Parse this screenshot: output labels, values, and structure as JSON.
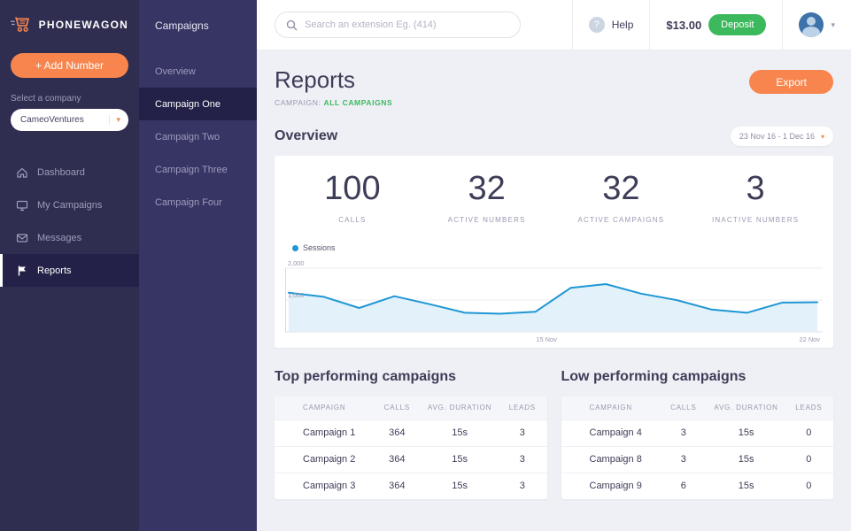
{
  "theme": {
    "accent": "#f8854e",
    "green": "#3cb95d",
    "chart_blue": "#1f97d4",
    "sidebar_bg": "#2f2e50",
    "subnav_bg": "#373564"
  },
  "brand": {
    "name": "PHONEWAGON"
  },
  "sidebar": {
    "add_number_label": "+ Add Number",
    "select_company_label": "Select a company",
    "company_selected": "CameoVentures",
    "items": [
      {
        "label": "Dashboard",
        "icon": "home"
      },
      {
        "label": "My Campaigns",
        "icon": "monitor"
      },
      {
        "label": "Messages",
        "icon": "envelope"
      },
      {
        "label": "Reports",
        "icon": "flag",
        "active": true
      }
    ]
  },
  "campaigns_panel": {
    "title": "Campaigns",
    "items": [
      "Overview",
      "Campaign One",
      "Campaign Two",
      "Campaign Three",
      "Campaign Four"
    ],
    "active_item": "Campaign One"
  },
  "topbar": {
    "search_placeholder": "Search an extension Eg. (414)",
    "help_label": "Help",
    "balance": "$13.00",
    "deposit_label": "Deposit"
  },
  "report": {
    "title": "Reports",
    "campaign_label": "CAMPAIGN:",
    "campaign_value": "ALL CAMPAIGNS",
    "export_label": "Export",
    "overview_title": "Overview",
    "date_range": "23 Nov 16  -  1 Dec 16",
    "stats": [
      {
        "value": "100",
        "label": "CALLS"
      },
      {
        "value": "32",
        "label": "ACTIVE NUMBERS"
      },
      {
        "value": "32",
        "label": "ACTIVE CAMPAIGNS"
      },
      {
        "value": "3",
        "label": "INACTIVE NUMBERS"
      }
    ]
  },
  "chart_data": {
    "type": "line",
    "title": "Sessions",
    "legend": [
      "Sessions"
    ],
    "color": "#1f97d4",
    "series": [
      {
        "name": "Sessions",
        "values": [
          1230,
          1100,
          750,
          1120,
          870,
          600,
          570,
          630,
          1380,
          1500,
          1200,
          1000,
          700,
          600,
          920,
          930
        ]
      }
    ],
    "ylim": [
      0,
      2200
    ],
    "ytick_labels": [
      "2,000",
      "1,000"
    ],
    "yticks": [
      2000,
      1000
    ],
    "xtick_labels": [
      "15 Nov",
      "22 Nov"
    ],
    "grid": true,
    "legend_position": "top-left"
  },
  "tables": {
    "top": {
      "title": "Top performing campaigns",
      "headers": [
        "CAMPAIGN",
        "CALLS",
        "AVG. DURATION",
        "LEADS"
      ],
      "rows": [
        [
          "Campaign 1",
          "364",
          "15s",
          "3"
        ],
        [
          "Campaign 2",
          "364",
          "15s",
          "3"
        ],
        [
          "Campaign 3",
          "364",
          "15s",
          "3"
        ]
      ]
    },
    "low": {
      "title": "Low performing campaigns",
      "headers": [
        "CAMPAIGN",
        "CALLS",
        "AVG. DURATION",
        "LEADS"
      ],
      "rows": [
        [
          "Campaign 4",
          "3",
          "15s",
          "0"
        ],
        [
          "Campaign 8",
          "3",
          "15s",
          "0"
        ],
        [
          "Campaign 9",
          "6",
          "15s",
          "0"
        ]
      ]
    }
  }
}
